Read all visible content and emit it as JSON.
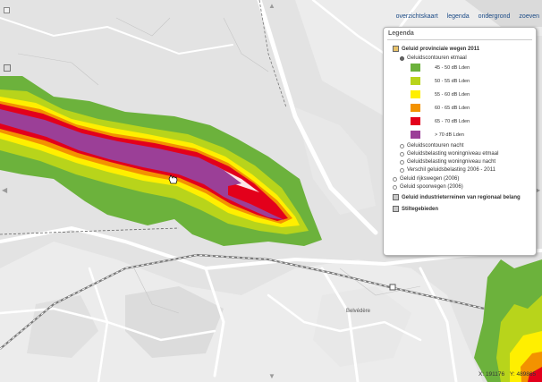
{
  "menu": {
    "items": [
      "overzichtskaart",
      "legenda",
      "ondergrond",
      "zoeven"
    ]
  },
  "legend": {
    "title": "Legenda",
    "main_layer": "Geluid provinciale wegen 2011",
    "contours_day": "Geluidscontouren etmaal",
    "classes": [
      {
        "label": "45 - 50 dB Lden",
        "color": "#6cb23c"
      },
      {
        "label": "50 - 55 dB Lden",
        "color": "#b8d41b"
      },
      {
        "label": "55 - 60 dB Lden",
        "color": "#ffef00"
      },
      {
        "label": "60 - 65 dB Lden",
        "color": "#f39200"
      },
      {
        "label": "65 - 70 dB Lden",
        "color": "#e3001b"
      },
      {
        "label": "> 70 dB Lden",
        "color": "#9b3f97"
      }
    ],
    "options": [
      "Geluidscontouren nacht",
      "Geluidsbelasting woningniveau etmaal",
      "Geluidsbelasting woningniveau nacht",
      "Verschil geluidsbelasting 2006 - 2011"
    ],
    "extra_layers": [
      "Geluid rijkswegen (2006)",
      "Geluid spoorwegen (2006)"
    ],
    "bold_layers": [
      "Geluid industrieterreinen van regionaal belang",
      "Stiltegebieden"
    ]
  },
  "map": {
    "place_label": "Belvédère"
  },
  "coords": {
    "x": "X: 191176",
    "y": "Y: 489865"
  },
  "colors": {
    "contour_45_50": "#6cb23c",
    "contour_50_55": "#b8d41b",
    "contour_55_60": "#ffef00",
    "contour_60_65": "#f39200",
    "contour_65_70": "#e3001b",
    "contour_70_plus": "#9b3f97",
    "map_background": "#e4e4e4",
    "menu_link": "#1a4a86"
  }
}
